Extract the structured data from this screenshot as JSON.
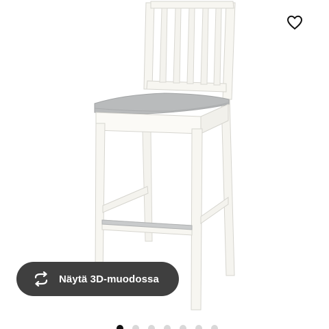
{
  "product": {
    "image_description_icon": "bar-stool-photo"
  },
  "favorite": {
    "icon": "heart-icon"
  },
  "view_3d": {
    "label": "Näytä 3D-muodossa",
    "icon": "rotate-3d-icon"
  },
  "gallery": {
    "total_images": 7,
    "active_index": 0
  },
  "colors": {
    "button_bg": "#3f3f3f",
    "seat_cushion": "#b9bbbc",
    "frame": "#f7f6f1"
  }
}
